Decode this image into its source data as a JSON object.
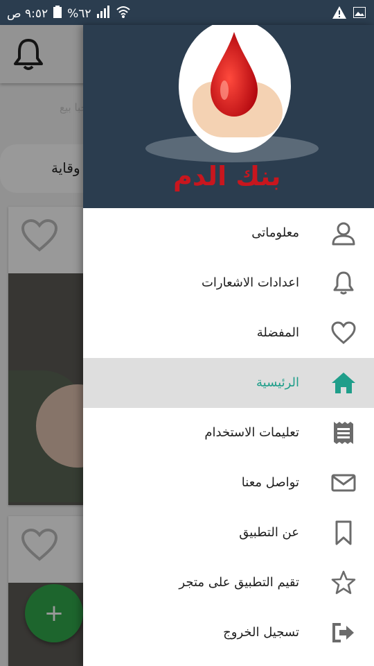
{
  "status_bar": {
    "time": "٩:٥٢ ص",
    "battery": "%٦٢",
    "icons": [
      "wifi-icon",
      "signal-icon",
      "battery-icon",
      "warning-icon",
      "image-icon"
    ]
  },
  "background": {
    "hint_text": "مرحبا بيع",
    "chip_label": "وقاية",
    "fab_label": "+"
  },
  "drawer": {
    "logo_text": "بنك الدم",
    "items": [
      {
        "label": "معلوماتى",
        "icon": "user-icon"
      },
      {
        "label": "اعدادات الاشعارات",
        "icon": "bell-icon"
      },
      {
        "label": "المفضلة",
        "icon": "heart-icon"
      },
      {
        "label": "الرئيسية",
        "icon": "home-icon",
        "active": true
      },
      {
        "label": "تعليمات الاستخدام",
        "icon": "receipt-icon"
      },
      {
        "label": "تواصل معنا",
        "icon": "envelope-icon"
      },
      {
        "label": "عن التطبيق",
        "icon": "bookmark-icon"
      },
      {
        "label": "تقيم التطبيق على متجر",
        "icon": "star-icon"
      },
      {
        "label": "تسجيل الخروج",
        "icon": "logout-icon"
      }
    ]
  },
  "colors": {
    "header": "#2b3d4f",
    "active_text": "#1f9e8a",
    "active_bg": "#dedede",
    "icon_gray": "#6b6b6b",
    "home_icon": "#1f9e8a",
    "fab": "#31a84b",
    "logo_red": "#c8161e"
  }
}
